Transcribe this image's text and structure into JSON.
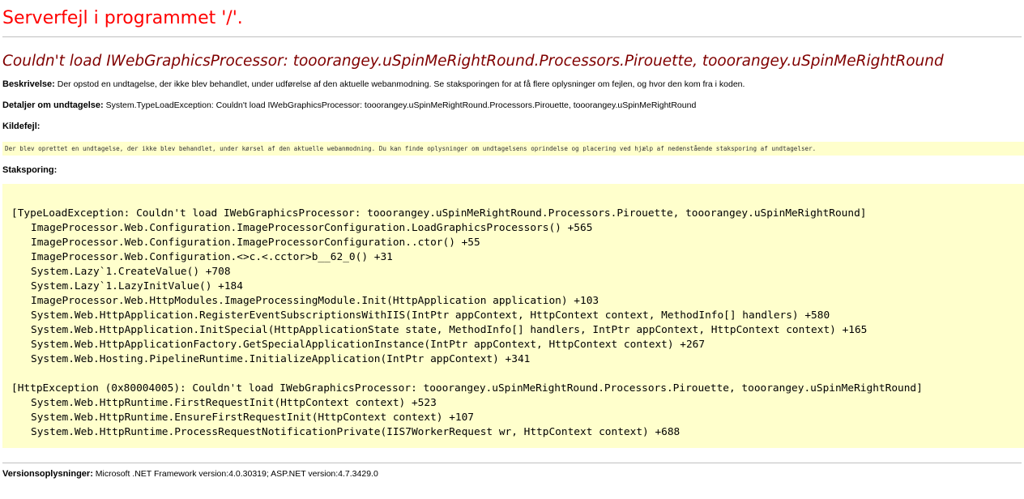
{
  "page": {
    "title": "Serverfejl i programmet '/'.",
    "error_heading": "Couldn't load IWebGraphicsProcessor: tooorangey.uSpinMeRightRound.Processors.Pirouette, tooorangey.uSpinMeRightRound",
    "description": {
      "label": "Beskrivelse:",
      "text": "Der opstod en undtagelse, der ikke blev behandlet, under udførelse af den aktuelle webanmodning. Se staksporingen for at få flere oplysninger om fejlen, og hvor den kom fra i koden."
    },
    "exception_details": {
      "label": "Detaljer om undtagelse:",
      "text": "System.TypeLoadException: Couldn't load IWebGraphicsProcessor: tooorangey.uSpinMeRightRound.Processors.Pirouette, tooorangey.uSpinMeRightRound"
    },
    "source_error": {
      "label": "Kildefejl:",
      "text": "Der blev oprettet en undtagelse, der ikke blev behandlet,  under kørsel af den aktuelle webanmodning. Du kan finde oplysninger om undtagelsens oprindelse og placering ved hjælp af nedenstående staksporing af undtagelser."
    },
    "stack_trace": {
      "label": "Staksporing:",
      "blocks": [
        {
          "header": "[TypeLoadException: Couldn't load IWebGraphicsProcessor: tooorangey.uSpinMeRightRound.Processors.Pirouette, tooorangey.uSpinMeRightRound]",
          "frames": [
            "ImageProcessor.Web.Configuration.ImageProcessorConfiguration.LoadGraphicsProcessors() +565",
            "ImageProcessor.Web.Configuration.ImageProcessorConfiguration..ctor() +55",
            "ImageProcessor.Web.Configuration.<>c.<.cctor>b__62_0() +31",
            "System.Lazy`1.CreateValue() +708",
            "System.Lazy`1.LazyInitValue() +184",
            "ImageProcessor.Web.HttpModules.ImageProcessingModule.Init(HttpApplication application) +103",
            "System.Web.HttpApplication.RegisterEventSubscriptionsWithIIS(IntPtr appContext, HttpContext context, MethodInfo[] handlers) +580",
            "System.Web.HttpApplication.InitSpecial(HttpApplicationState state, MethodInfo[] handlers, IntPtr appContext, HttpContext context) +165",
            "System.Web.HttpApplicationFactory.GetSpecialApplicationInstance(IntPtr appContext, HttpContext context) +267",
            "System.Web.Hosting.PipelineRuntime.InitializeApplication(IntPtr appContext) +341"
          ]
        },
        {
          "header": "[HttpException (0x80004005): Couldn't load IWebGraphicsProcessor: tooorangey.uSpinMeRightRound.Processors.Pirouette, tooorangey.uSpinMeRightRound]",
          "frames": [
            "System.Web.HttpRuntime.FirstRequestInit(HttpContext context) +523",
            "System.Web.HttpRuntime.EnsureFirstRequestInit(HttpContext context) +107",
            "System.Web.HttpRuntime.ProcessRequestNotificationPrivate(IIS7WorkerRequest wr, HttpContext context) +688"
          ]
        }
      ]
    },
    "version_info": {
      "label": "Versionsoplysninger:",
      "text": "Microsoft .NET Framework version:4.0.30319; ASP.NET version:4.7.3429.0"
    },
    "colors": {
      "title": "#ff0000",
      "heading": "#800000",
      "code_background": "#ffffcc",
      "rule": "#c0c0c0"
    }
  }
}
